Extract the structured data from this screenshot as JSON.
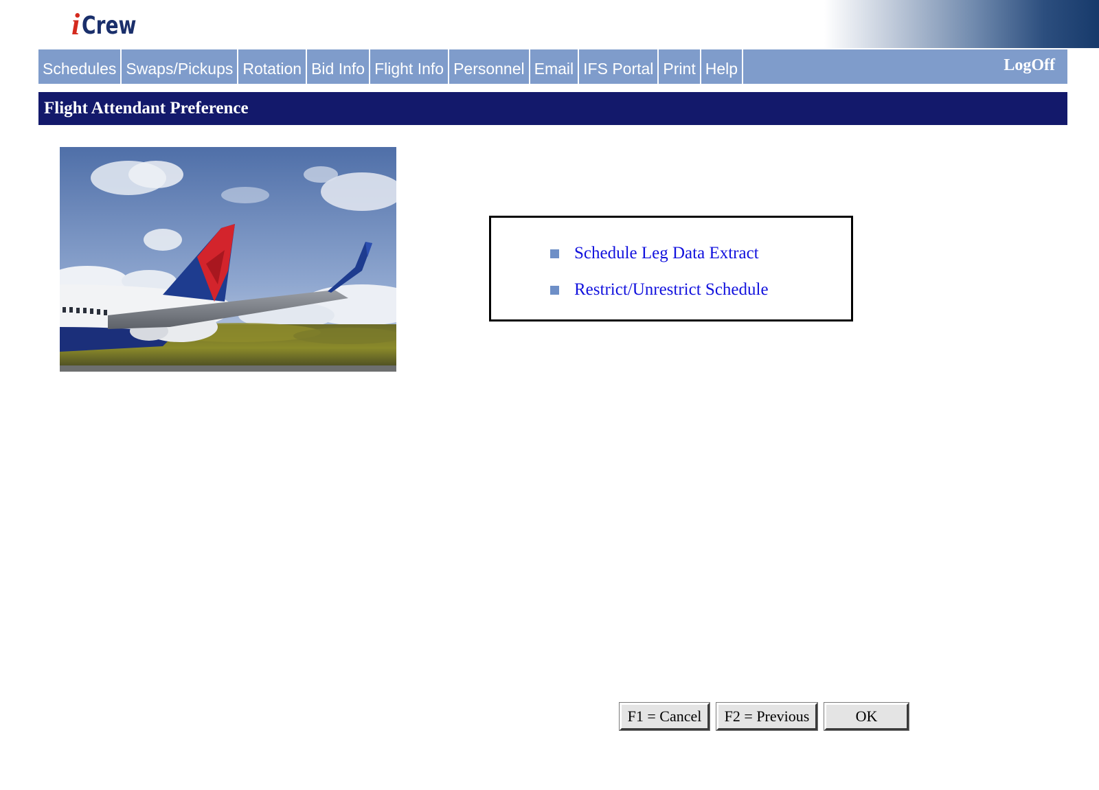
{
  "app": {
    "logo_i": "i",
    "logo_crew": "Crew"
  },
  "nav": {
    "items": [
      {
        "label": "Schedules"
      },
      {
        "label": "Swaps/Pickups"
      },
      {
        "label": "Rotation"
      },
      {
        "label": "Bid Info"
      },
      {
        "label": "Flight Info"
      },
      {
        "label": "Personnel"
      },
      {
        "label": "Email"
      },
      {
        "label": "IFS Portal"
      },
      {
        "label": "Print"
      },
      {
        "label": "Help"
      }
    ],
    "logoff_label": "LogOff"
  },
  "page": {
    "title": "Flight Attendant Preference"
  },
  "menu": {
    "items": [
      {
        "label": "Schedule Leg Data Extract"
      },
      {
        "label": "Restrict/Unrestrict Schedule"
      }
    ]
  },
  "buttons": {
    "cancel": "F1 = Cancel",
    "previous": "F2 = Previous",
    "ok": "OK"
  },
  "colors": {
    "nav_bg": "#7f9ccb",
    "title_bg": "#13196b",
    "link": "#1111dd",
    "bullet": "#6e8fc7",
    "logo_i": "#d42a1e",
    "logo_crew": "#1a2f6b"
  }
}
